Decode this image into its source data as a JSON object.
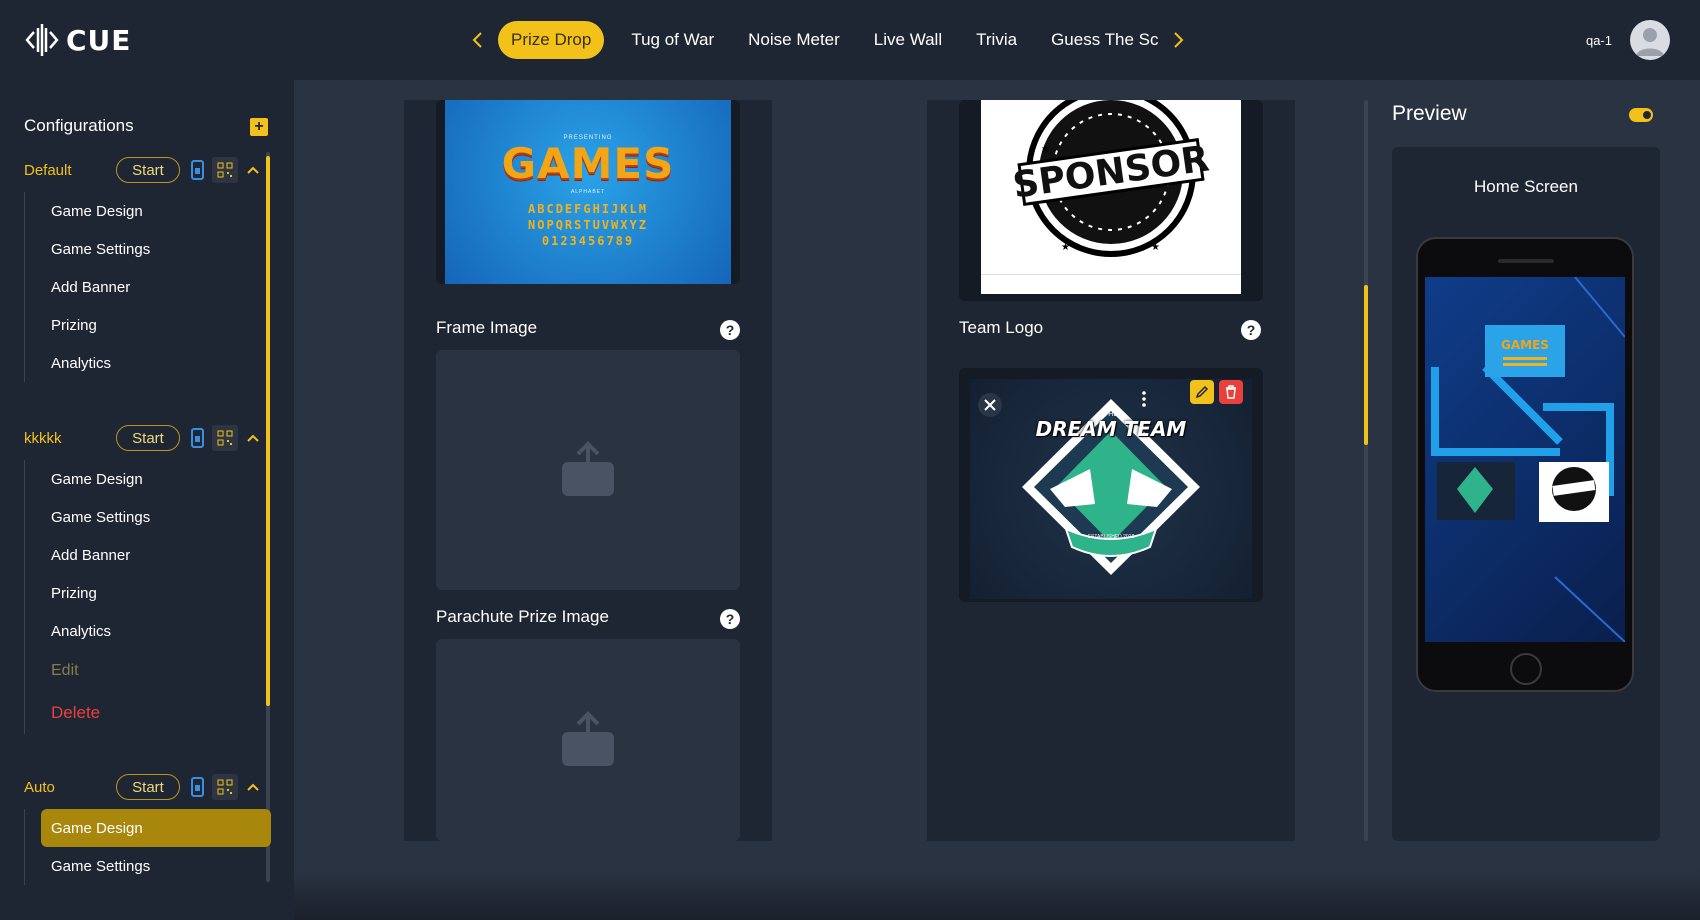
{
  "app": {
    "logo_text": "CUE"
  },
  "nav": {
    "tabs": [
      {
        "label": "Prize Drop",
        "active": true
      },
      {
        "label": "Tug of War"
      },
      {
        "label": "Noise Meter"
      },
      {
        "label": "Live Wall"
      },
      {
        "label": "Trivia"
      },
      {
        "label": "Guess The Sc"
      }
    ],
    "prev_icon": "chevron-left-icon",
    "next_icon": "chevron-right-icon"
  },
  "user": {
    "name": "qa-1",
    "avatar_icon": "user-avatar-icon"
  },
  "sidebar": {
    "heading": "Configurations",
    "add_icon": "plus-icon",
    "groups": [
      {
        "name": "Default",
        "start_label": "Start",
        "items": [
          "Game Design",
          "Game Settings",
          "Add Banner",
          "Prizing",
          "Analytics"
        ]
      },
      {
        "name": "kkkkk",
        "start_label": "Start",
        "items": [
          "Game Design",
          "Game Settings",
          "Add Banner",
          "Prizing",
          "Analytics"
        ],
        "edit_label": "Edit",
        "delete_label": "Delete"
      },
      {
        "name": "Auto",
        "start_label": "Start",
        "items": [
          "Game Design",
          "Game Settings"
        ],
        "active_item": "Game Design"
      }
    ]
  },
  "editor": {
    "games_banner": {
      "presenting": "PRESENTING",
      "title": "GAMES",
      "subtitle": "ALPHABET",
      "line1": "ABCDEFGHIJKLM",
      "line2": "NOPQRSTUVWXYZ",
      "line3": "0123456789"
    },
    "sponsor_image": {
      "stamp_text": "SPONSOR"
    },
    "fields": {
      "frame_image": "Frame Image",
      "parachute_prize_image": "Parachute Prize Image",
      "team_logo": "Team Logo"
    },
    "team_logo": {
      "top_text": "THE",
      "title": "DREAM TEAM",
      "ribbon": "ESTABLISHED 2018"
    }
  },
  "preview": {
    "title": "Preview",
    "screen_label": "Home Screen",
    "toggle_on": true,
    "accent_color": "#f2c21b"
  },
  "colors": {
    "accent": "#f2c21b",
    "delete": "#e8413c",
    "background": "#1f2633",
    "panel": "#2a3342"
  }
}
